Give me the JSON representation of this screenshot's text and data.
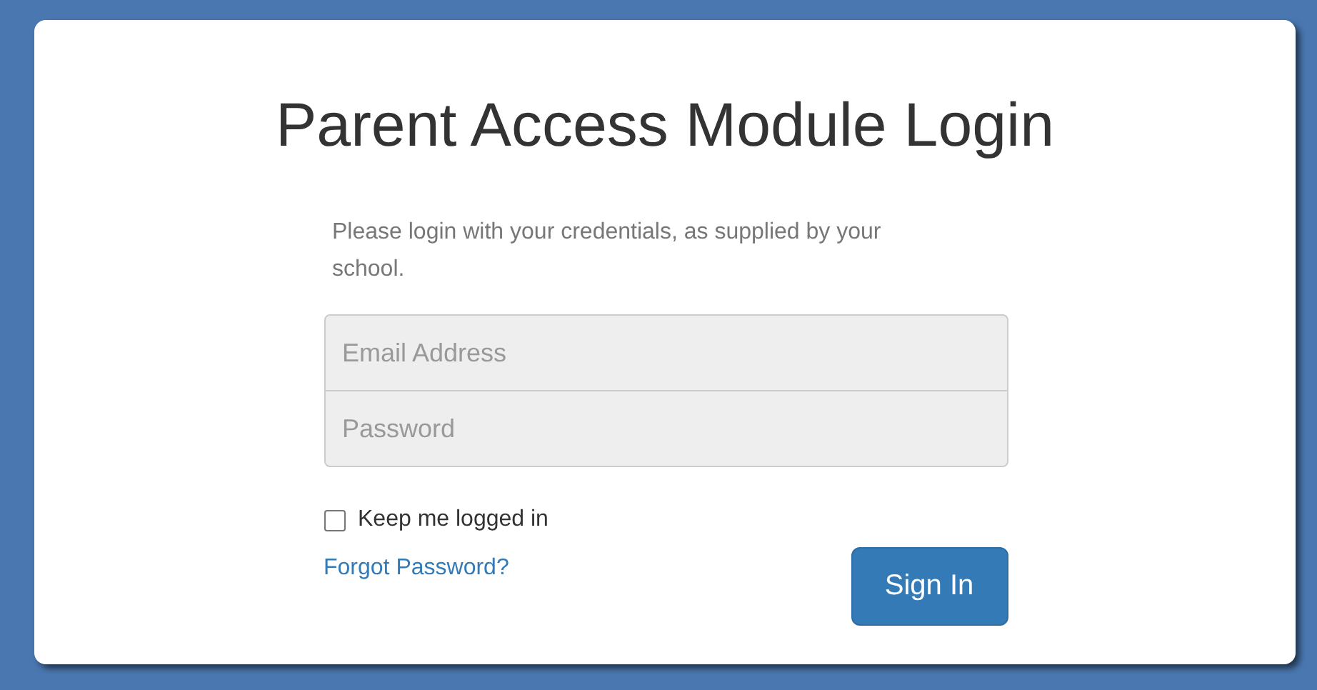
{
  "title": "Parent Access Module Login",
  "intro": "Please login with your credentials, as supplied by your school.",
  "fields": [
    {
      "placeholder": "Email Address"
    },
    {
      "placeholder": "Password"
    }
  ],
  "remember": {
    "label": "Keep me logged in",
    "checked": false
  },
  "forgot_link": "Forgot Password?",
  "submit": "Sign In"
}
